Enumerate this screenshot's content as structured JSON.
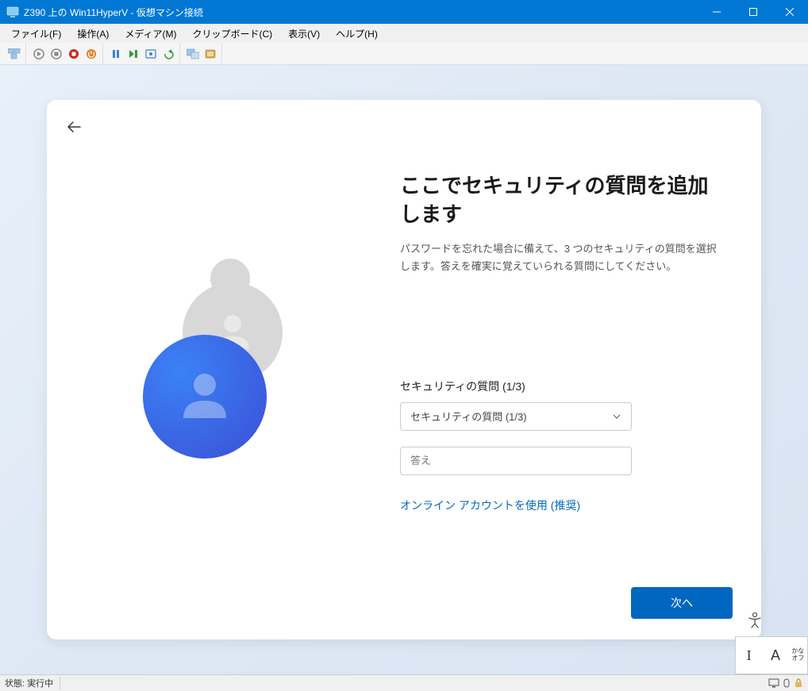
{
  "titlebar": {
    "text": "Z390 上の Win11HyperV - 仮想マシン接続"
  },
  "menubar": {
    "items": [
      "ファイル(F)",
      "操作(A)",
      "メディア(M)",
      "クリップボード(C)",
      "表示(V)",
      "ヘルプ(H)"
    ]
  },
  "oobe": {
    "title": "ここでセキュリティの質問を追加します",
    "subtitle": "パスワードを忘れた場合に備えて、3 つのセキュリティの質問を選択します。答えを確実に覚えていられる質問にしてください。",
    "field_label": "セキュリティの質問 (1/3)",
    "select_placeholder": "セキュリティの質問 (1/3)",
    "answer_placeholder": "答え",
    "link_text": "オンライン アカウントを使用 (推奨)",
    "next_label": "次へ"
  },
  "ime": {
    "cursor": "I",
    "mode": "A",
    "kana": "かな",
    "off": "オフ"
  },
  "statusbar": {
    "text": "状態: 実行中"
  }
}
